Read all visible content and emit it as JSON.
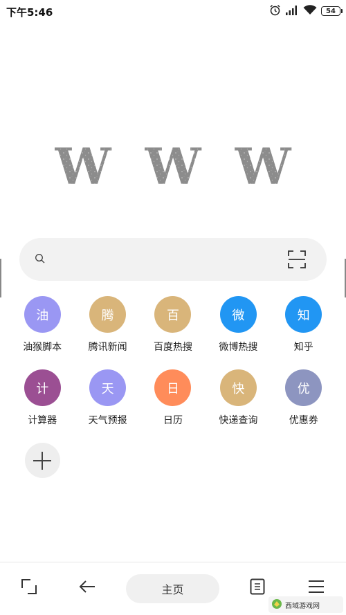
{
  "status_bar": {
    "time": "下午5:46",
    "battery": "54"
  },
  "logo": {
    "letters": [
      "W",
      "W",
      "W"
    ]
  },
  "search": {
    "placeholder": ""
  },
  "shortcuts": [
    {
      "char": "油",
      "label": "油猴脚本",
      "color": "#9a97f3"
    },
    {
      "char": "腾",
      "label": "腾讯新闻",
      "color": "#d9b57a"
    },
    {
      "char": "百",
      "label": "百度热搜",
      "color": "#d9b57a"
    },
    {
      "char": "微",
      "label": "微博热搜",
      "color": "#2196f3"
    },
    {
      "char": "知",
      "label": "知乎",
      "color": "#2196f3"
    },
    {
      "char": "计",
      "label": "计算器",
      "color": "#9b4f93"
    },
    {
      "char": "天",
      "label": "天气预报",
      "color": "#9a97f3"
    },
    {
      "char": "日",
      "label": "日历",
      "color": "#ff8c5a"
    },
    {
      "char": "快",
      "label": "快递查询",
      "color": "#d9b57a"
    },
    {
      "char": "优",
      "label": "优惠券",
      "color": "#8d95c0"
    }
  ],
  "bottom_nav": {
    "home_label": "主页"
  },
  "watermark": {
    "text": "西域游戏网"
  },
  "icons": {
    "status": [
      "alarm-icon",
      "signal-icon",
      "wifi-icon",
      "battery-icon"
    ],
    "search": "search-icon",
    "scan": "scan-icon",
    "add": "plus-icon",
    "nav": [
      "fullscreen-icon",
      "back-arrow-icon",
      "tabs-icon",
      "menu-icon"
    ]
  }
}
